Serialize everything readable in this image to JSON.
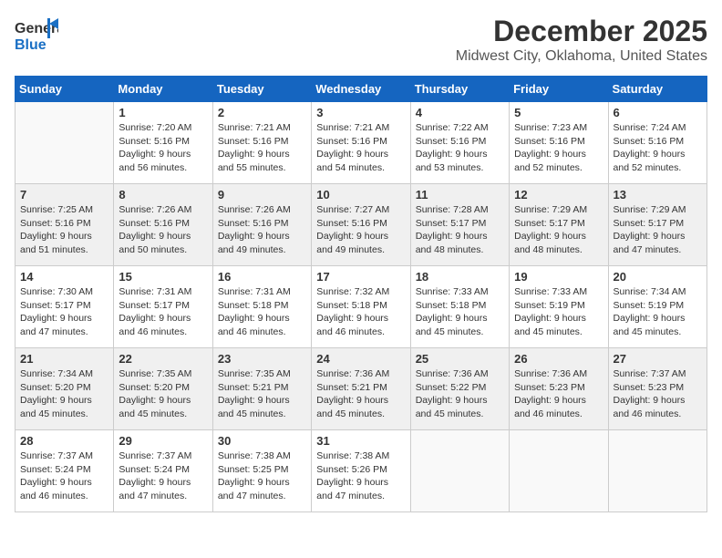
{
  "logo": {
    "general": "General",
    "blue": "Blue"
  },
  "title": {
    "month_year": "December 2025",
    "location": "Midwest City, Oklahoma, United States"
  },
  "days_of_week": [
    "Sunday",
    "Monday",
    "Tuesday",
    "Wednesday",
    "Thursday",
    "Friday",
    "Saturday"
  ],
  "weeks": [
    [
      {
        "day": "",
        "sunrise": "",
        "sunset": "",
        "daylight": "",
        "empty": true
      },
      {
        "day": "1",
        "sunrise": "Sunrise: 7:20 AM",
        "sunset": "Sunset: 5:16 PM",
        "daylight": "Daylight: 9 hours and 56 minutes."
      },
      {
        "day": "2",
        "sunrise": "Sunrise: 7:21 AM",
        "sunset": "Sunset: 5:16 PM",
        "daylight": "Daylight: 9 hours and 55 minutes."
      },
      {
        "day": "3",
        "sunrise": "Sunrise: 7:21 AM",
        "sunset": "Sunset: 5:16 PM",
        "daylight": "Daylight: 9 hours and 54 minutes."
      },
      {
        "day": "4",
        "sunrise": "Sunrise: 7:22 AM",
        "sunset": "Sunset: 5:16 PM",
        "daylight": "Daylight: 9 hours and 53 minutes."
      },
      {
        "day": "5",
        "sunrise": "Sunrise: 7:23 AM",
        "sunset": "Sunset: 5:16 PM",
        "daylight": "Daylight: 9 hours and 52 minutes."
      },
      {
        "day": "6",
        "sunrise": "Sunrise: 7:24 AM",
        "sunset": "Sunset: 5:16 PM",
        "daylight": "Daylight: 9 hours and 52 minutes."
      }
    ],
    [
      {
        "day": "7",
        "sunrise": "Sunrise: 7:25 AM",
        "sunset": "Sunset: 5:16 PM",
        "daylight": "Daylight: 9 hours and 51 minutes."
      },
      {
        "day": "8",
        "sunrise": "Sunrise: 7:26 AM",
        "sunset": "Sunset: 5:16 PM",
        "daylight": "Daylight: 9 hours and 50 minutes."
      },
      {
        "day": "9",
        "sunrise": "Sunrise: 7:26 AM",
        "sunset": "Sunset: 5:16 PM",
        "daylight": "Daylight: 9 hours and 49 minutes."
      },
      {
        "day": "10",
        "sunrise": "Sunrise: 7:27 AM",
        "sunset": "Sunset: 5:16 PM",
        "daylight": "Daylight: 9 hours and 49 minutes."
      },
      {
        "day": "11",
        "sunrise": "Sunrise: 7:28 AM",
        "sunset": "Sunset: 5:17 PM",
        "daylight": "Daylight: 9 hours and 48 minutes."
      },
      {
        "day": "12",
        "sunrise": "Sunrise: 7:29 AM",
        "sunset": "Sunset: 5:17 PM",
        "daylight": "Daylight: 9 hours and 48 minutes."
      },
      {
        "day": "13",
        "sunrise": "Sunrise: 7:29 AM",
        "sunset": "Sunset: 5:17 PM",
        "daylight": "Daylight: 9 hours and 47 minutes."
      }
    ],
    [
      {
        "day": "14",
        "sunrise": "Sunrise: 7:30 AM",
        "sunset": "Sunset: 5:17 PM",
        "daylight": "Daylight: 9 hours and 47 minutes."
      },
      {
        "day": "15",
        "sunrise": "Sunrise: 7:31 AM",
        "sunset": "Sunset: 5:17 PM",
        "daylight": "Daylight: 9 hours and 46 minutes."
      },
      {
        "day": "16",
        "sunrise": "Sunrise: 7:31 AM",
        "sunset": "Sunset: 5:18 PM",
        "daylight": "Daylight: 9 hours and 46 minutes."
      },
      {
        "day": "17",
        "sunrise": "Sunrise: 7:32 AM",
        "sunset": "Sunset: 5:18 PM",
        "daylight": "Daylight: 9 hours and 46 minutes."
      },
      {
        "day": "18",
        "sunrise": "Sunrise: 7:33 AM",
        "sunset": "Sunset: 5:18 PM",
        "daylight": "Daylight: 9 hours and 45 minutes."
      },
      {
        "day": "19",
        "sunrise": "Sunrise: 7:33 AM",
        "sunset": "Sunset: 5:19 PM",
        "daylight": "Daylight: 9 hours and 45 minutes."
      },
      {
        "day": "20",
        "sunrise": "Sunrise: 7:34 AM",
        "sunset": "Sunset: 5:19 PM",
        "daylight": "Daylight: 9 hours and 45 minutes."
      }
    ],
    [
      {
        "day": "21",
        "sunrise": "Sunrise: 7:34 AM",
        "sunset": "Sunset: 5:20 PM",
        "daylight": "Daylight: 9 hours and 45 minutes."
      },
      {
        "day": "22",
        "sunrise": "Sunrise: 7:35 AM",
        "sunset": "Sunset: 5:20 PM",
        "daylight": "Daylight: 9 hours and 45 minutes."
      },
      {
        "day": "23",
        "sunrise": "Sunrise: 7:35 AM",
        "sunset": "Sunset: 5:21 PM",
        "daylight": "Daylight: 9 hours and 45 minutes."
      },
      {
        "day": "24",
        "sunrise": "Sunrise: 7:36 AM",
        "sunset": "Sunset: 5:21 PM",
        "daylight": "Daylight: 9 hours and 45 minutes."
      },
      {
        "day": "25",
        "sunrise": "Sunrise: 7:36 AM",
        "sunset": "Sunset: 5:22 PM",
        "daylight": "Daylight: 9 hours and 45 minutes."
      },
      {
        "day": "26",
        "sunrise": "Sunrise: 7:36 AM",
        "sunset": "Sunset: 5:23 PM",
        "daylight": "Daylight: 9 hours and 46 minutes."
      },
      {
        "day": "27",
        "sunrise": "Sunrise: 7:37 AM",
        "sunset": "Sunset: 5:23 PM",
        "daylight": "Daylight: 9 hours and 46 minutes."
      }
    ],
    [
      {
        "day": "28",
        "sunrise": "Sunrise: 7:37 AM",
        "sunset": "Sunset: 5:24 PM",
        "daylight": "Daylight: 9 hours and 46 minutes."
      },
      {
        "day": "29",
        "sunrise": "Sunrise: 7:37 AM",
        "sunset": "Sunset: 5:24 PM",
        "daylight": "Daylight: 9 hours and 47 minutes."
      },
      {
        "day": "30",
        "sunrise": "Sunrise: 7:38 AM",
        "sunset": "Sunset: 5:25 PM",
        "daylight": "Daylight: 9 hours and 47 minutes."
      },
      {
        "day": "31",
        "sunrise": "Sunrise: 7:38 AM",
        "sunset": "Sunset: 5:26 PM",
        "daylight": "Daylight: 9 hours and 47 minutes."
      },
      {
        "day": "",
        "sunrise": "",
        "sunset": "",
        "daylight": "",
        "empty": true
      },
      {
        "day": "",
        "sunrise": "",
        "sunset": "",
        "daylight": "",
        "empty": true
      },
      {
        "day": "",
        "sunrise": "",
        "sunset": "",
        "daylight": "",
        "empty": true
      }
    ]
  ]
}
